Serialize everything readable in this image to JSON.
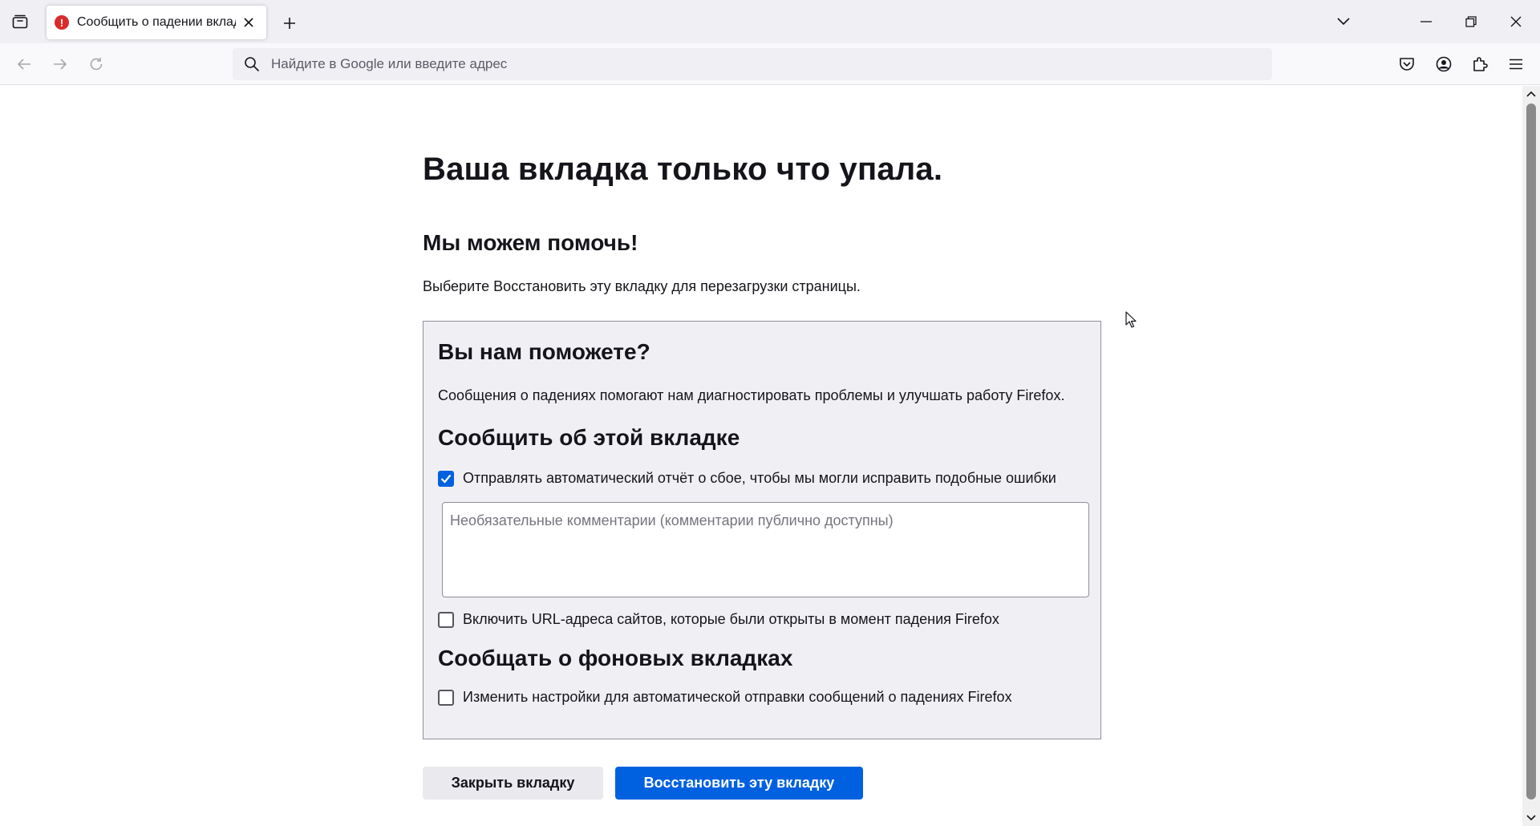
{
  "tab": {
    "title": "Сообщить о падении вкладки",
    "icon": "crash-warning-icon",
    "icon_color": "#d92b2b"
  },
  "urlbar": {
    "placeholder": "Найдите в Google или введите адрес",
    "value": ""
  },
  "page": {
    "title": "Ваша вкладка только что упала.",
    "subtitle": "Мы можем помочь!",
    "intro": "Выберите Восстановить эту вкладку для перезагрузки страницы."
  },
  "report": {
    "heading": "Вы нам поможете?",
    "description": "Сообщения о падениях помогают нам диагностировать проблемы и улучшать работу Firefox.",
    "tab_section_heading": "Сообщить об этой вкладке",
    "auto_report_label": "Отправлять автоматический отчёт о сбое, чтобы мы могли исправить подобные ошибки",
    "auto_report_checked": true,
    "comments_placeholder": "Необязательные комментарии (комментарии публично доступны)",
    "comments_value": "",
    "include_urls_label": "Включить URL-адреса сайтов, которые были открыты в момент падения Firefox",
    "include_urls_checked": false,
    "background_heading": "Сообщать о фоновых вкладках",
    "auto_submit_label": "Изменить настройки для автоматической отправки сообщений о падениях Firefox",
    "auto_submit_checked": false
  },
  "buttons": {
    "close_tab": "Закрыть вкладку",
    "restore_tab": "Восстановить эту вкладку"
  },
  "colors": {
    "accent": "#0061e0",
    "report_box_bg": "#f0f0f4",
    "tabstrip_bg": "#f0f0f4"
  }
}
